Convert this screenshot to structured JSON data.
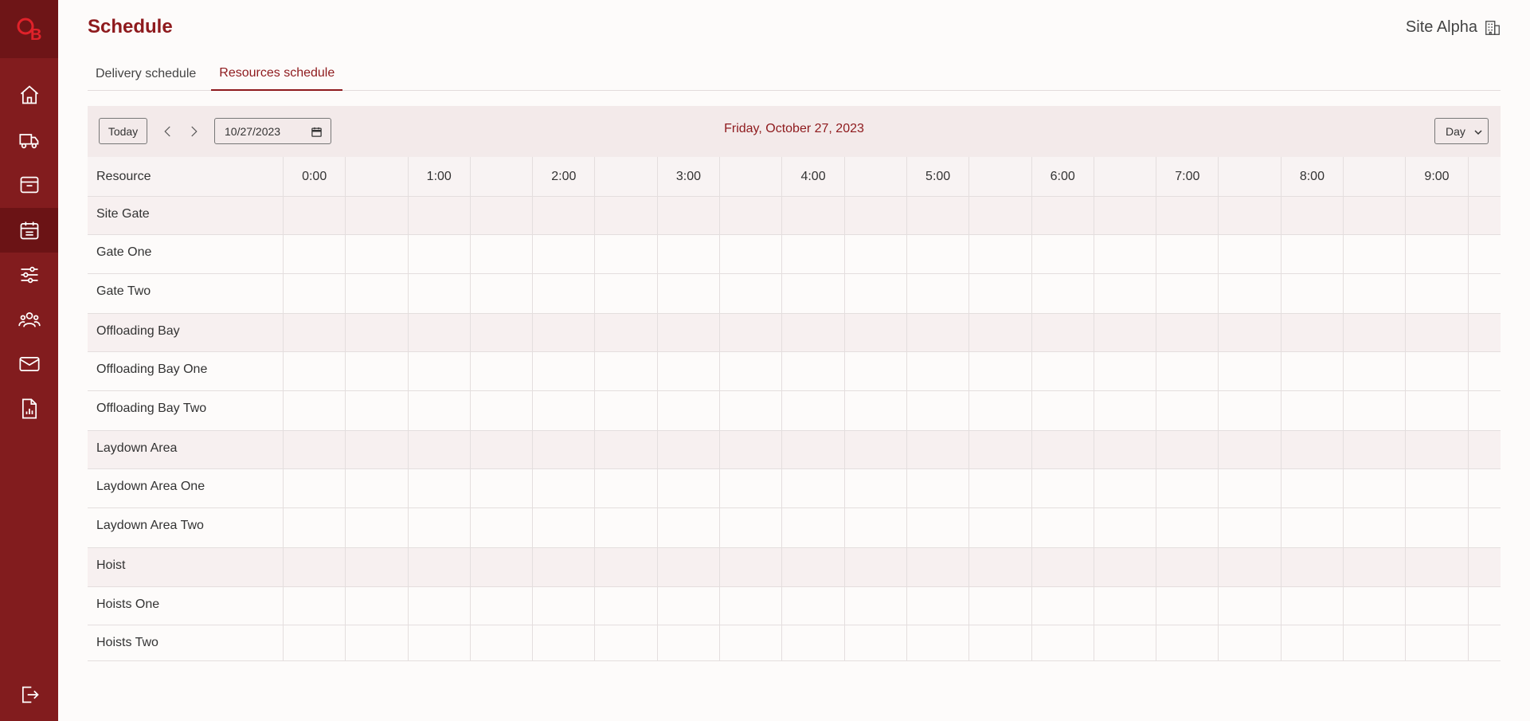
{
  "app": {
    "page_title": "Schedule",
    "site_name": "Site Alpha"
  },
  "sidebar": {
    "items": [
      {
        "icon": "home-icon",
        "active": false
      },
      {
        "icon": "truck-icon",
        "active": false
      },
      {
        "icon": "inbox-icon",
        "active": false
      },
      {
        "icon": "calendar-icon",
        "active": true
      },
      {
        "icon": "sliders-icon",
        "active": false
      },
      {
        "icon": "users-icon",
        "active": false
      },
      {
        "icon": "mail-icon",
        "active": false
      },
      {
        "icon": "report-icon",
        "active": false
      }
    ],
    "logout_icon": "logout-icon"
  },
  "tabs": [
    {
      "label": "Delivery schedule",
      "active": false
    },
    {
      "label": "Resources schedule",
      "active": true
    }
  ],
  "toolbar": {
    "today_label": "Today",
    "date_value": "10/27/2023",
    "date_title": "Friday, October 27, 2023",
    "view_value": "Day"
  },
  "grid": {
    "resource_header": "Resource",
    "hours": [
      "0:00",
      "1:00",
      "2:00",
      "3:00",
      "4:00",
      "5:00",
      "6:00",
      "7:00",
      "8:00",
      "9:00"
    ],
    "rows": [
      {
        "label": "Site Gate",
        "kind": "group"
      },
      {
        "label": "Gate One",
        "kind": "item"
      },
      {
        "label": "Gate Two",
        "kind": "item"
      },
      {
        "label": "Offloading Bay",
        "kind": "group"
      },
      {
        "label": "Offloading Bay One",
        "kind": "item"
      },
      {
        "label": "Offloading Bay Two",
        "kind": "item"
      },
      {
        "label": "Laydown Area",
        "kind": "group"
      },
      {
        "label": "Laydown Area One",
        "kind": "item"
      },
      {
        "label": "Laydown Area Two",
        "kind": "item"
      },
      {
        "label": "Hoist",
        "kind": "group"
      },
      {
        "label": "Hoists One",
        "kind": "item"
      },
      {
        "label": "Hoists Two",
        "kind": "item"
      }
    ]
  },
  "colors": {
    "sidebar": "#821c1e",
    "accent": "#8e1a1d",
    "toolbar_bg": "#f3eaea"
  }
}
